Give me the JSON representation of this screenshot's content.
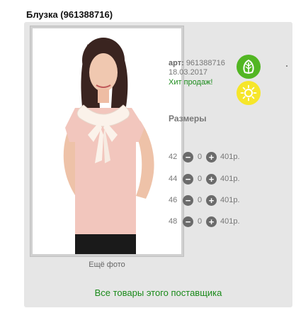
{
  "product": {
    "title": "Блузка (961388716)",
    "art_label": "арт:",
    "art_value": "961388716",
    "date": "18.03.2017",
    "hit": "Хит продаж!"
  },
  "gallery": {
    "more_photo": "Ещё фото"
  },
  "badges": {
    "eco": "leaf-icon",
    "summer": "sun-icon",
    "eco_color": "#52b623",
    "summer_color": "#f6e62a"
  },
  "sizes": {
    "title": "Размеры",
    "items": [
      {
        "size": "42",
        "qty": "0",
        "price": "401р."
      },
      {
        "size": "44",
        "qty": "0",
        "price": "401р."
      },
      {
        "size": "46",
        "qty": "0",
        "price": "401р."
      },
      {
        "size": "48",
        "qty": "0",
        "price": "401р."
      }
    ],
    "minus_symbol": "−",
    "plus_symbol": "+"
  },
  "footer": {
    "supplier_link": "Все товары этого поставщика"
  },
  "colors": {
    "accent_green": "#1a8a1a",
    "card_bg": "#e6e6e6"
  }
}
